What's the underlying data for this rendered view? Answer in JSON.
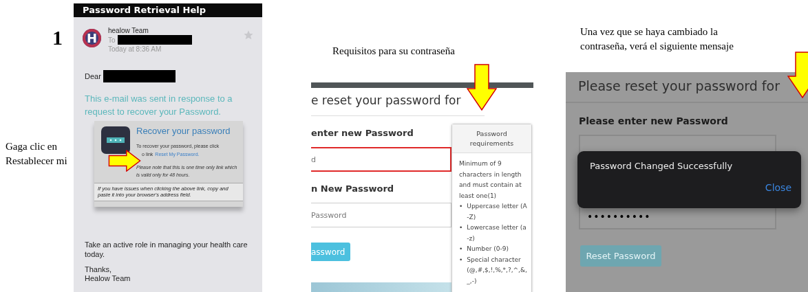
{
  "step_number": "1",
  "left_caption": "Gaga clic en Restablecer mi",
  "email": {
    "header": "Password Retrieval Help",
    "avatar_letter": "H",
    "sender": "healow Team",
    "to_label": "To",
    "time": "Today at 8:36 AM",
    "greeting": "Dear",
    "intro": "This e-mail was sent in response to a request to recover your Password.",
    "card": {
      "title": "Recover your password",
      "line1": "To recover your password, please click",
      "line2": "o link",
      "link": "Reset My Password.",
      "note": "Please note that this is one time only link which is valid only for 48 hours.",
      "footer": "If you have issues when clicking the above link, copy and paste it into your browser's address field."
    },
    "closing": "Take an active role in managing your health care today.",
    "thanks": "Thanks,",
    "signature": "Healow Team"
  },
  "requirements_screen": {
    "caption": "Requisitos para su contraseña",
    "title": "e reset your password for",
    "new_label": "enter new Password",
    "new_placeholder": "d",
    "new_invalid": true,
    "confirm_label": "n New Password",
    "confirm_placeholder": "Password",
    "button": "assword",
    "tooltip": {
      "title": "Password requirements",
      "bullet": "•",
      "intro": "Minimum of 9 characters in length and must contain at least one(1)",
      "items": [
        "Uppercase letter (A-Z)",
        "Lowercase letter (a-z)",
        "Number (0-9)",
        "Special character (@,#,$,!,%,*,?,^,&,_,-)"
      ]
    }
  },
  "success_screen": {
    "caption": "Una vez que se haya cambiado la contraseña, verá el siguiente mensaje",
    "title": "Please reset your password for",
    "new_label": "Please enter new Password",
    "confirm_value": "••••••••••",
    "button": "Reset Password",
    "dialog": {
      "message": "Password Changed Successfully",
      "action": "Close"
    }
  }
}
